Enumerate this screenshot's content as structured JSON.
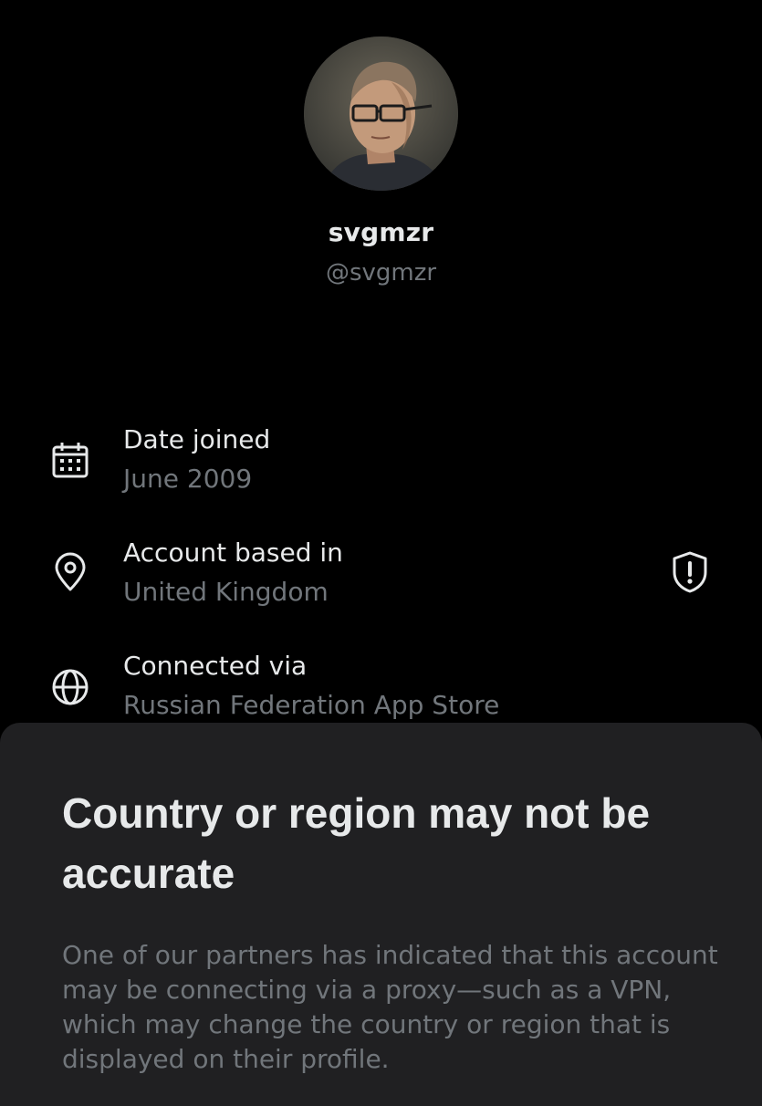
{
  "profile": {
    "display_name": "svgmzr",
    "handle": "@svgmzr"
  },
  "info": {
    "date_joined": {
      "label": "Date joined",
      "value": "June 2009",
      "icon": "calendar-icon"
    },
    "account_based": {
      "label": "Account based in",
      "value": "United Kingdom",
      "icon": "location-pin-icon",
      "warning_icon": "shield-alert-icon"
    },
    "connected_via": {
      "label": "Connected via",
      "value": "Russian Federation App Store",
      "icon": "globe-icon"
    }
  },
  "sheet": {
    "title": "Country or region may not be accurate",
    "body": "One of our partners has indicated that this account may be connecting via a proxy—such as a VPN, which may change the country or region that is displayed on their profile."
  },
  "colors": {
    "background": "#000000",
    "primary_text": "#e7e9ea",
    "secondary_text": "#71767b",
    "sheet_background": "#202022"
  }
}
